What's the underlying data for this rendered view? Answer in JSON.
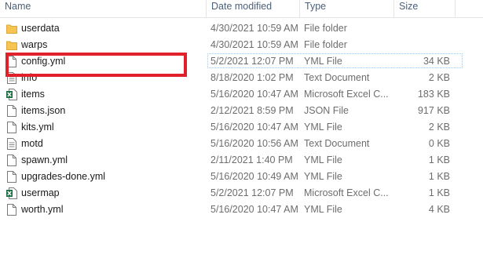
{
  "columns": {
    "name": "Name",
    "date": "Date modified",
    "type": "Type",
    "size": "Size"
  },
  "files": [
    {
      "name": "userdata",
      "date": "4/30/2021 10:59 AM",
      "type": "File folder",
      "size": "",
      "icon": "folder-icon"
    },
    {
      "name": "warps",
      "date": "4/30/2021 10:59 AM",
      "type": "File folder",
      "size": "",
      "icon": "folder-icon"
    },
    {
      "name": "config.yml",
      "date": "5/2/2021 12:07 PM",
      "type": "YML File",
      "size": "34 KB",
      "icon": "file-icon"
    },
    {
      "name": "info",
      "date": "8/18/2020 1:02 PM",
      "type": "Text Document",
      "size": "2 KB",
      "icon": "text-file-icon"
    },
    {
      "name": "items",
      "date": "5/16/2020 10:47 AM",
      "type": "Microsoft Excel C...",
      "size": "183 KB",
      "icon": "excel-icon"
    },
    {
      "name": "items.json",
      "date": "2/12/2021 8:59 PM",
      "type": "JSON File",
      "size": "917 KB",
      "icon": "file-icon"
    },
    {
      "name": "kits.yml",
      "date": "5/16/2020 10:47 AM",
      "type": "YML File",
      "size": "2 KB",
      "icon": "file-icon"
    },
    {
      "name": "motd",
      "date": "5/16/2020 10:56 AM",
      "type": "Text Document",
      "size": "0 KB",
      "icon": "text-file-icon"
    },
    {
      "name": "spawn.yml",
      "date": "2/11/2021 1:40 PM",
      "type": "YML File",
      "size": "1 KB",
      "icon": "file-icon"
    },
    {
      "name": "upgrades-done.yml",
      "date": "5/16/2020 10:49 AM",
      "type": "YML File",
      "size": "1 KB",
      "icon": "file-icon"
    },
    {
      "name": "usermap",
      "date": "5/2/2021 12:07 PM",
      "type": "Microsoft Excel C...",
      "size": "1 KB",
      "icon": "excel-icon"
    },
    {
      "name": "worth.yml",
      "date": "5/16/2020 10:47 AM",
      "type": "YML File",
      "size": "4 KB",
      "icon": "file-icon"
    }
  ],
  "colors": {
    "highlight": "#e0202b",
    "header_text": "#4c607a",
    "folder": "#f5c451",
    "excel": "#1d7044"
  }
}
